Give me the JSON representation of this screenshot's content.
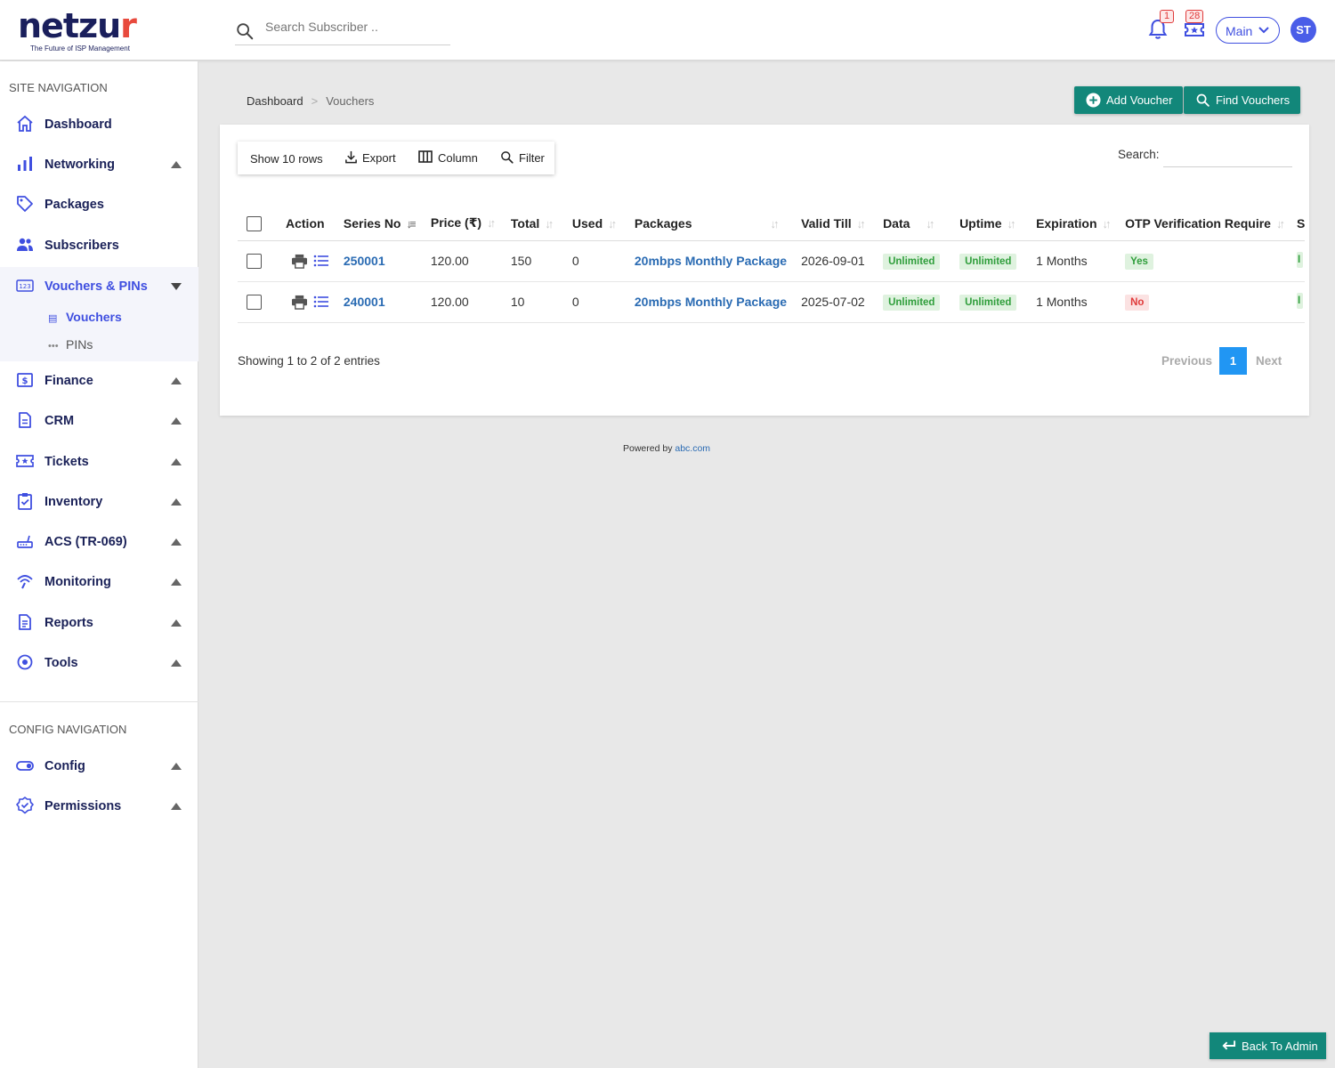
{
  "brand": {
    "name_left": "netzu",
    "name_accent": "r",
    "tagline": "The Future of ISP Management"
  },
  "header": {
    "search_placeholder": "Search Subscriber ..",
    "notifications_count": "1",
    "tickets_count": "28",
    "location_select": "Main",
    "avatar_initials": "ST"
  },
  "sidebar": {
    "site_section": "SITE NAVIGATION",
    "items": [
      {
        "label": "Dashboard",
        "icon": "home-icon"
      },
      {
        "label": "Networking",
        "icon": "bar-chart-icon"
      },
      {
        "label": "Packages",
        "icon": "tag-icon"
      },
      {
        "label": "Subscribers",
        "icon": "users-icon"
      },
      {
        "label": "Vouchers & PINs",
        "icon": "numbers-icon"
      },
      {
        "label": "Finance",
        "icon": "dollar-icon"
      },
      {
        "label": "CRM",
        "icon": "document-icon"
      },
      {
        "label": "Tickets",
        "icon": "ticket-icon"
      },
      {
        "label": "Inventory",
        "icon": "clipboard-check-icon"
      },
      {
        "label": "ACS (TR-069)",
        "icon": "router-icon"
      },
      {
        "label": "Monitoring",
        "icon": "signal-icon"
      },
      {
        "label": "Reports",
        "icon": "report-icon"
      },
      {
        "label": "Tools",
        "icon": "tools-icon"
      }
    ],
    "sub_items": [
      {
        "label": "Vouchers",
        "icon": "list-icon"
      },
      {
        "label": "PINs",
        "icon": "dots-icon"
      }
    ],
    "config_section": "CONFIG NAVIGATION",
    "config_items": [
      {
        "label": "Config",
        "icon": "toggle-icon"
      },
      {
        "label": "Permissions",
        "icon": "badge-check-icon"
      }
    ]
  },
  "breadcrumb": {
    "root": "Dashboard",
    "separator": ">",
    "current": "Vouchers"
  },
  "actions": {
    "add_voucher": "Add Voucher",
    "find_vouchers": "Find Vouchers"
  },
  "toolbar": {
    "show_rows": "Show 10 rows",
    "export": "Export",
    "column": "Column",
    "filter": "Filter",
    "search_label": "Search:"
  },
  "table": {
    "columns": [
      "Action",
      "Series No",
      "Price (₹)",
      "Total",
      "Used",
      "Packages",
      "Valid Till",
      "Data",
      "Uptime",
      "Expiration",
      "OTP Verification Require",
      "S"
    ],
    "rows": [
      {
        "series_no": "250001",
        "price": "120.00",
        "total": "150",
        "used": "0",
        "package": "20mbps Monthly Package",
        "valid_till": "2026-09-01",
        "data": "Unlimited",
        "uptime": "Unlimited",
        "expiration": "1 Months",
        "otp": "Yes",
        "status": "I"
      },
      {
        "series_no": "240001",
        "price": "120.00",
        "total": "10",
        "used": "0",
        "package": "20mbps Monthly Package",
        "valid_till": "2025-07-02",
        "data": "Unlimited",
        "uptime": "Unlimited",
        "expiration": "1 Months",
        "otp": "No",
        "status": "I"
      }
    ],
    "info": "Showing 1 to 2 of 2 entries"
  },
  "pagination": {
    "previous": "Previous",
    "page": "1",
    "next": "Next"
  },
  "footer": {
    "powered_text": "Powered by",
    "powered_link": "abc.com"
  },
  "back_admin": "Back To Admin",
  "colors": {
    "brand_navy": "#1a1f5c",
    "accent_red": "#e84a3d",
    "primary_blue": "#3f4fe0",
    "teal": "#12877a",
    "link_blue": "#2a6bb3",
    "page_blue": "#2196f3"
  }
}
